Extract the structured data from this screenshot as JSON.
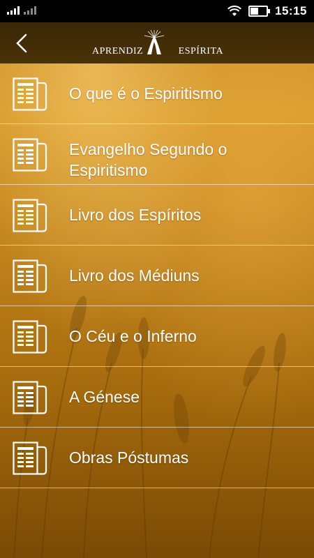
{
  "status_bar": {
    "time": "15:15",
    "icons": [
      "signal-icon",
      "signal-2-icon",
      "wifi-icon",
      "battery-icon"
    ]
  },
  "app_bar": {
    "back_icon": "chevron-left-icon",
    "logo": {
      "left_text": "APRENDIZ",
      "right_text": "ESPÍRITA"
    }
  },
  "menu": {
    "items": [
      {
        "label": "O que é o Espiritismo",
        "icon": "newspaper-icon"
      },
      {
        "label": "Evangelho Segundo o Espiritismo",
        "icon": "newspaper-icon"
      },
      {
        "label": "Livro dos Espíritos",
        "icon": "newspaper-icon"
      },
      {
        "label": "Livro dos Médiuns",
        "icon": "newspaper-icon"
      },
      {
        "label": "O Céu e o Inferno",
        "icon": "newspaper-icon"
      },
      {
        "label": "A Génese",
        "icon": "newspaper-icon"
      },
      {
        "label": "Obras Póstumas",
        "icon": "newspaper-icon"
      }
    ]
  },
  "colors": {
    "status_bar": "#000000",
    "app_bar": "#3f2a06",
    "background": "#c0821a",
    "text": "#ffffff"
  }
}
